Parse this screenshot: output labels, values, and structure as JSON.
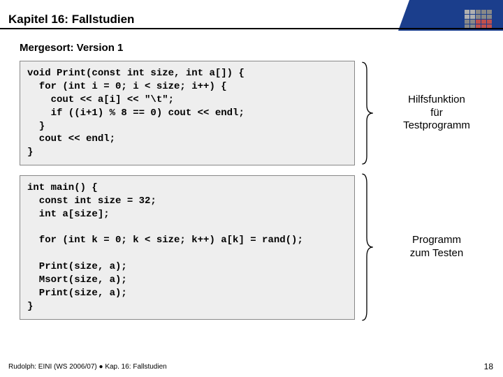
{
  "header": {
    "chapter_title": "Kapitel 16: Fallstudien"
  },
  "subtitle": "Mergesort: Version 1",
  "code_block_1": "void Print(const int size, int a[]) {\n  for (int i = 0; i < size; i++) {\n    cout << a[i] << \"\\t\";\n    if ((i+1) % 8 == 0) cout << endl;\n  }\n  cout << endl;\n}",
  "annotation_1": "Hilfsfunktion\nfür\nTestprogramm",
  "code_block_2": "int main() {\n  const int size = 32;\n  int a[size];\n\n  for (int k = 0; k < size; k++) a[k] = rand();\n\n  Print(size, a);\n  Msort(size, a);\n  Print(size, a);\n}",
  "annotation_2": "Programm\nzum Testen",
  "footer": {
    "left": "Rudolph: EINI (WS 2006/07)  ●  Kap. 16: Fallstudien",
    "page": "18"
  }
}
